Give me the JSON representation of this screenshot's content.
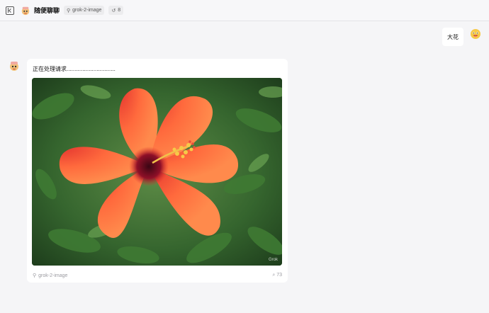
{
  "header": {
    "title": "随便聊聊",
    "model_chip": "grok-2-image",
    "history_chip": "8"
  },
  "messages": {
    "user": {
      "text": "大花"
    },
    "assistant": {
      "text": "正在处理请求...............................",
      "image_watermark": "Grok",
      "footer_model": "grok-2-image",
      "footer_count": "73"
    }
  },
  "icons": {
    "panel_toggle": "sidebar-toggle-icon",
    "model": "robot-icon",
    "history": "history-icon",
    "attachment": "paperclip-icon"
  },
  "colors": {
    "background": "#f5f5f7",
    "bubble": "#ffffff",
    "chip": "#ececee"
  }
}
